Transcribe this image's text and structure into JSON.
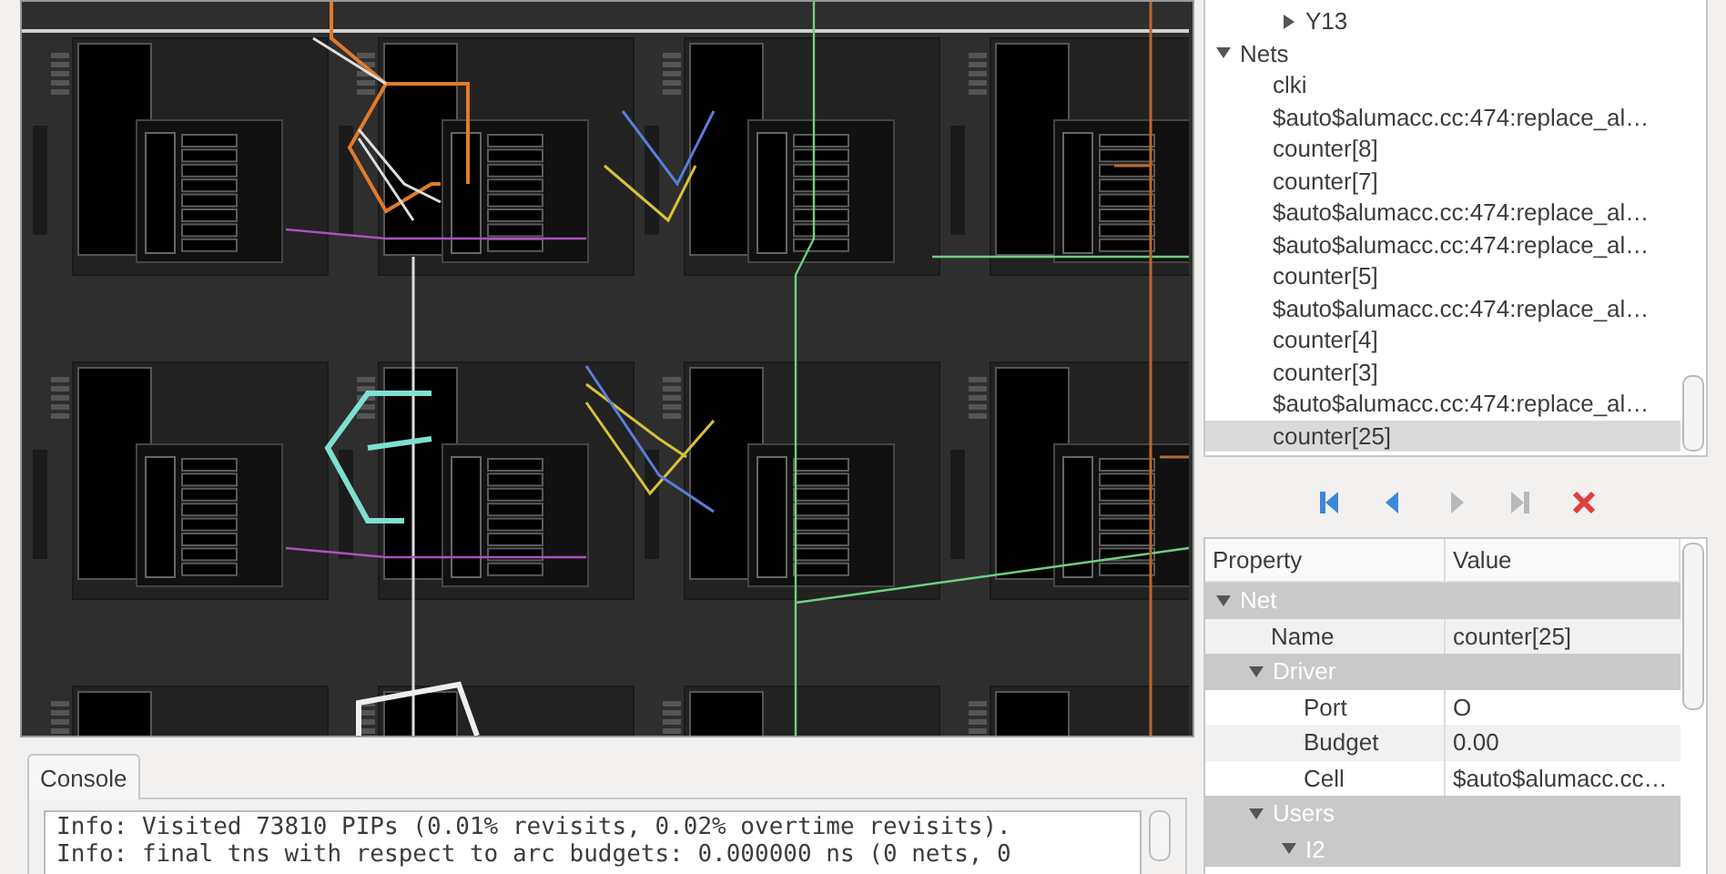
{
  "tree": {
    "items": [
      {
        "kind": "continued",
        "children": [
          {
            "label": "Y13",
            "expanded": false
          }
        ]
      },
      {
        "label": "Nets",
        "expanded": true,
        "children": [
          {
            "label": "clki",
            "selected": false
          },
          {
            "label": "$auto$alumacc.cc:474:replace_al…",
            "selected": false
          },
          {
            "label": "counter[8]",
            "selected": false
          },
          {
            "label": "counter[7]",
            "selected": false
          },
          {
            "label": "$auto$alumacc.cc:474:replace_al…",
            "selected": false
          },
          {
            "label": "$auto$alumacc.cc:474:replace_al…",
            "selected": false
          },
          {
            "label": "counter[5]",
            "selected": false
          },
          {
            "label": "$auto$alumacc.cc:474:replace_al…",
            "selected": false
          },
          {
            "label": "counter[4]",
            "selected": false
          },
          {
            "label": "counter[3]",
            "selected": false
          },
          {
            "label": "$auto$alumacc.cc:474:replace_al…",
            "selected": false
          },
          {
            "label": "counter[25]",
            "selected": true
          }
        ]
      }
    ]
  },
  "nav_buttons": [
    {
      "kind": "first",
      "disabled": false
    },
    {
      "kind": "back",
      "disabled": false
    },
    {
      "kind": "forward",
      "disabled": true
    },
    {
      "kind": "last",
      "disabled": true
    },
    {
      "kind": "clear",
      "disabled": false
    }
  ],
  "properties": {
    "columns": [
      "Property",
      "Value"
    ],
    "rows": [
      {
        "name": "Net",
        "kind": "group",
        "expanded": true,
        "children": [
          {
            "name": "Name",
            "value": "counter[25]"
          },
          {
            "name": "Driver",
            "kind": "group",
            "expanded": true,
            "children": [
              {
                "name": "Port",
                "value": "O"
              },
              {
                "name": "Budget",
                "value": "0.00"
              },
              {
                "name": "Cell",
                "value": "$auto$alumacc.cc…"
              }
            ]
          },
          {
            "name": "Users",
            "kind": "group",
            "expanded": true,
            "children": [
              {
                "name": "I2",
                "kind": "group",
                "expanded": true
              }
            ]
          }
        ]
      }
    ]
  },
  "console": {
    "tab": "Console",
    "lines": [
      "Info: Visited 73810 PIPs (0.01% revisits, 0.02% overtime revisits).",
      "Info: final tns with respect to arc budgets: 0.000000 ns (0 nets, 0"
    ]
  }
}
